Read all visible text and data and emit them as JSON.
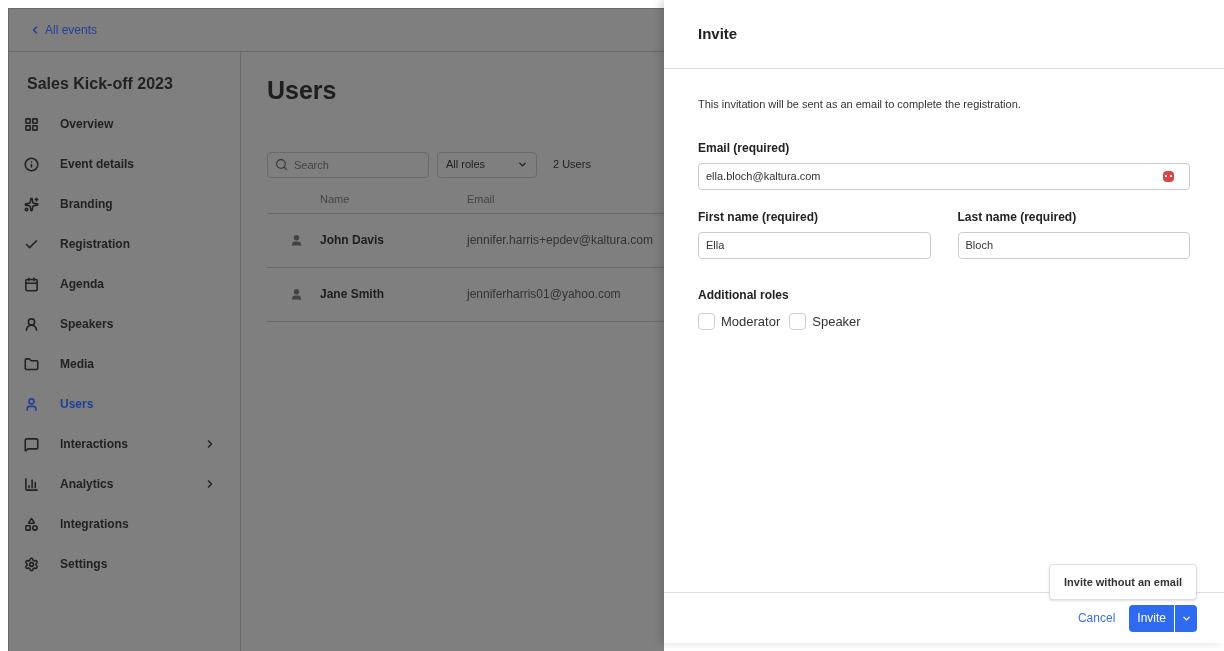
{
  "back_link": {
    "label": "All events"
  },
  "sidebar": {
    "title": "Sales Kick-off 2023",
    "items": [
      {
        "label": "Overview",
        "selected": false,
        "expandable": false
      },
      {
        "label": "Event details",
        "selected": false,
        "expandable": false
      },
      {
        "label": "Branding",
        "selected": false,
        "expandable": false
      },
      {
        "label": "Registration",
        "selected": false,
        "expandable": false
      },
      {
        "label": "Agenda",
        "selected": false,
        "expandable": false
      },
      {
        "label": "Speakers",
        "selected": false,
        "expandable": false
      },
      {
        "label": "Media",
        "selected": false,
        "expandable": false
      },
      {
        "label": "Users",
        "selected": true,
        "expandable": false
      },
      {
        "label": "Interactions",
        "selected": false,
        "expandable": true
      },
      {
        "label": "Analytics",
        "selected": false,
        "expandable": true
      },
      {
        "label": "Integrations",
        "selected": false,
        "expandable": false
      },
      {
        "label": "Settings",
        "selected": false,
        "expandable": false
      }
    ]
  },
  "page": {
    "title": "Users",
    "search": {
      "placeholder": "Search"
    },
    "role_filter": {
      "value": "All roles"
    },
    "count": "2 Users",
    "table": {
      "columns": [
        "Name",
        "Email"
      ],
      "rows": [
        {
          "name": "John Davis",
          "email": "jennifer.harris+epdev@kaltura.com"
        },
        {
          "name": "Jane Smith",
          "email": "jenniferharris01@yahoo.com"
        }
      ]
    }
  },
  "dialog": {
    "title": "Invite",
    "intro": "This invitation will be sent as an email to complete the registration.",
    "email": {
      "label": "Email (required)",
      "value": "ella.bloch@kaltura.com"
    },
    "first_name": {
      "label": "First name (required)",
      "value": "Ella"
    },
    "last_name": {
      "label": "Last name (required)",
      "value": "Bloch"
    },
    "roles": {
      "label": "Additional roles",
      "options": [
        {
          "label": "Moderator",
          "checked": false
        },
        {
          "label": "Speaker",
          "checked": false
        }
      ]
    },
    "menu_item": "Invite without an email",
    "cancel": "Cancel",
    "invite": "Invite"
  }
}
